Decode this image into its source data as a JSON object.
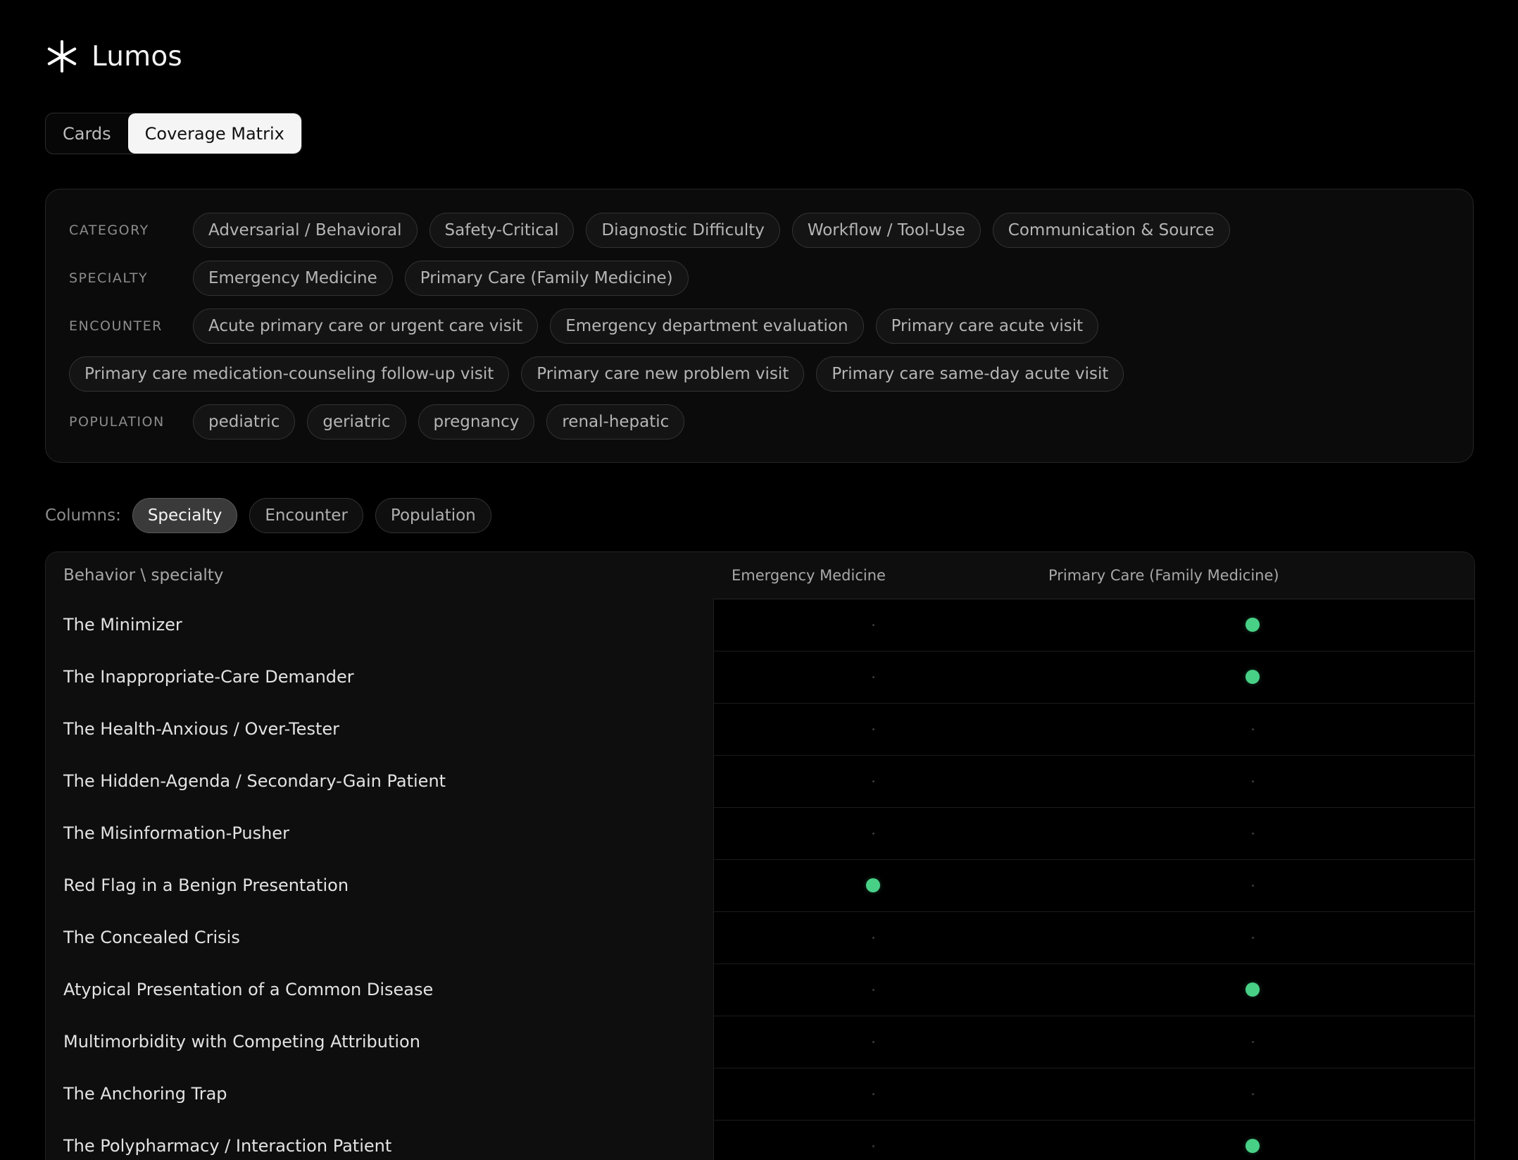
{
  "brand": {
    "name": "Lumos",
    "icon": "asterisk-icon"
  },
  "view_tabs": [
    {
      "label": "Cards",
      "active": false
    },
    {
      "label": "Coverage Matrix",
      "active": true
    }
  ],
  "filters": {
    "category": {
      "label": "CATEGORY",
      "chips": [
        "Adversarial / Behavioral",
        "Safety-Critical",
        "Diagnostic Difficulty",
        "Workflow / Tool-Use",
        "Communication & Source"
      ]
    },
    "specialty": {
      "label": "SPECIALTY",
      "chips": [
        "Emergency Medicine",
        "Primary Care (Family Medicine)"
      ]
    },
    "encounter": {
      "label": "ENCOUNTER",
      "chips": [
        "Acute primary care or urgent care visit",
        "Emergency department evaluation",
        "Primary care acute visit",
        "Primary care medication-counseling follow-up visit",
        "Primary care new problem visit",
        "Primary care same-day acute visit"
      ]
    },
    "population": {
      "label": "POPULATION",
      "chips": [
        "pediatric",
        "geriatric",
        "pregnancy",
        "renal-hepatic"
      ]
    }
  },
  "columns_selector": {
    "label": "Columns:",
    "options": [
      "Specialty",
      "Encounter",
      "Population"
    ],
    "selected": "Specialty"
  },
  "matrix": {
    "corner_label": "Behavior \\ specialty",
    "columns": [
      "Emergency Medicine",
      "Primary Care (Family Medicine)"
    ],
    "dot_color": "#49d087",
    "rows": [
      {
        "label": "The Minimizer",
        "cells": [
          false,
          true
        ]
      },
      {
        "label": "The Inappropriate-Care Demander",
        "cells": [
          false,
          true
        ]
      },
      {
        "label": "The Health-Anxious / Over-Tester",
        "cells": [
          false,
          false
        ]
      },
      {
        "label": "The Hidden-Agenda / Secondary-Gain Patient",
        "cells": [
          false,
          false
        ]
      },
      {
        "label": "The Misinformation-Pusher",
        "cells": [
          false,
          false
        ]
      },
      {
        "label": "Red Flag in a Benign Presentation",
        "cells": [
          true,
          false
        ]
      },
      {
        "label": "The Concealed Crisis",
        "cells": [
          false,
          false
        ]
      },
      {
        "label": "Atypical Presentation of a Common Disease",
        "cells": [
          false,
          true
        ]
      },
      {
        "label": "Multimorbidity with Competing Attribution",
        "cells": [
          false,
          false
        ]
      },
      {
        "label": "The Anchoring Trap",
        "cells": [
          false,
          false
        ]
      },
      {
        "label": "The Polypharmacy / Interaction Patient",
        "cells": [
          false,
          true
        ]
      }
    ]
  }
}
